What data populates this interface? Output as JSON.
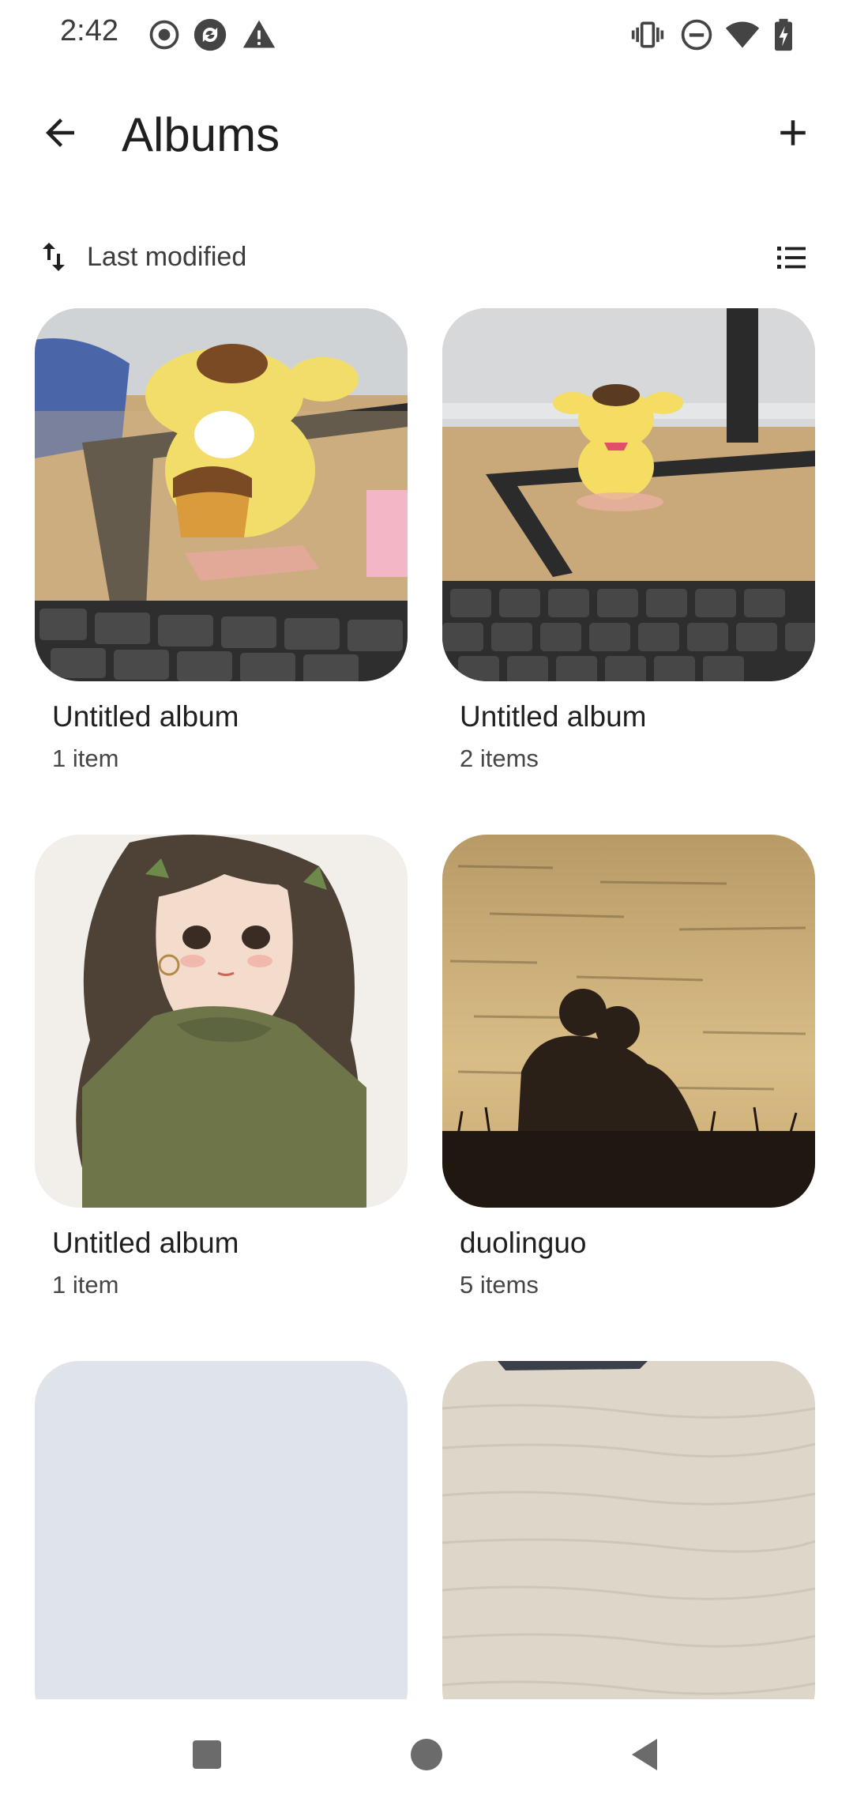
{
  "status_bar": {
    "time": "2:42",
    "left_icons": [
      "record-icon",
      "sync-icon",
      "warning-icon"
    ],
    "right_icons": [
      "vibrate-icon",
      "do-not-disturb-icon",
      "wifi-icon",
      "battery-charging-icon"
    ]
  },
  "app_bar": {
    "title": "Albums",
    "back_icon": "arrow-back-icon",
    "add_icon": "plus-icon"
  },
  "sort": {
    "label": "Last modified",
    "icon": "swap-vert-icon",
    "view_toggle_icon": "list-view-icon"
  },
  "albums": [
    {
      "title": "Untitled album",
      "count": "1 item",
      "thumbnail": "pompompurin figure with keyboard"
    },
    {
      "title": "Untitled album",
      "count": "2 items",
      "thumbnail": "yellow figure on desk"
    },
    {
      "title": "Untitled album",
      "count": "1 item",
      "thumbnail": "illustrated girl with curly hair"
    },
    {
      "title": "duolinguo",
      "count": "5 items",
      "thumbnail": "couple silhouette by water"
    },
    {
      "title": "",
      "count": "",
      "thumbnail": "empty placeholder"
    },
    {
      "title": "",
      "count": "",
      "thumbnail": "wood texture"
    }
  ],
  "nav_bar": {
    "icons": [
      "recents-square-icon",
      "home-circle-icon",
      "back-triangle-icon"
    ]
  },
  "colors": {
    "background": "#ffffff",
    "text_primary": "#1f1f1f",
    "text_secondary": "#444746",
    "placeholder": "#dfe3ea"
  }
}
